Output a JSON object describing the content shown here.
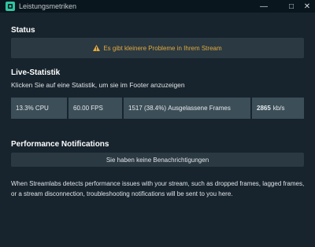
{
  "window": {
    "title": "Leistungsmetriken",
    "icon": "streamlabs-app-icon",
    "controls": {
      "minimize": "—",
      "maximize": "□",
      "close": "✕"
    }
  },
  "status": {
    "heading": "Status",
    "icon": "warning-icon",
    "message": "Es gibt kleinere Probleme in Ihrem Stream",
    "color": "#e3a83d"
  },
  "live_stats": {
    "heading": "Live-Statistik",
    "hint": "Klicken Sie auf eine Statistik, um sie im Footer anzuzeigen",
    "items": [
      {
        "value": "13.3%",
        "label": "CPU"
      },
      {
        "value": "60.00",
        "label": "FPS"
      },
      {
        "value": "1517 (38.4%)",
        "label": "Ausgelassene Frames"
      },
      {
        "value": "2865",
        "label": "kb/s"
      }
    ]
  },
  "notifications": {
    "heading": "Performance Notifications",
    "empty_message": "Sie haben keine Benachrichtigungen",
    "description": "When Streamlabs detects performance issues with your stream, such as dropped frames, lagged frames, or a stream disconnection, troubleshooting notifications will be sent to you here."
  },
  "colors": {
    "background": "#17242d",
    "titlebar": "#09161d",
    "panel": "#2a3942",
    "stat": "#3c4e58",
    "accent": "#31c3a2"
  }
}
